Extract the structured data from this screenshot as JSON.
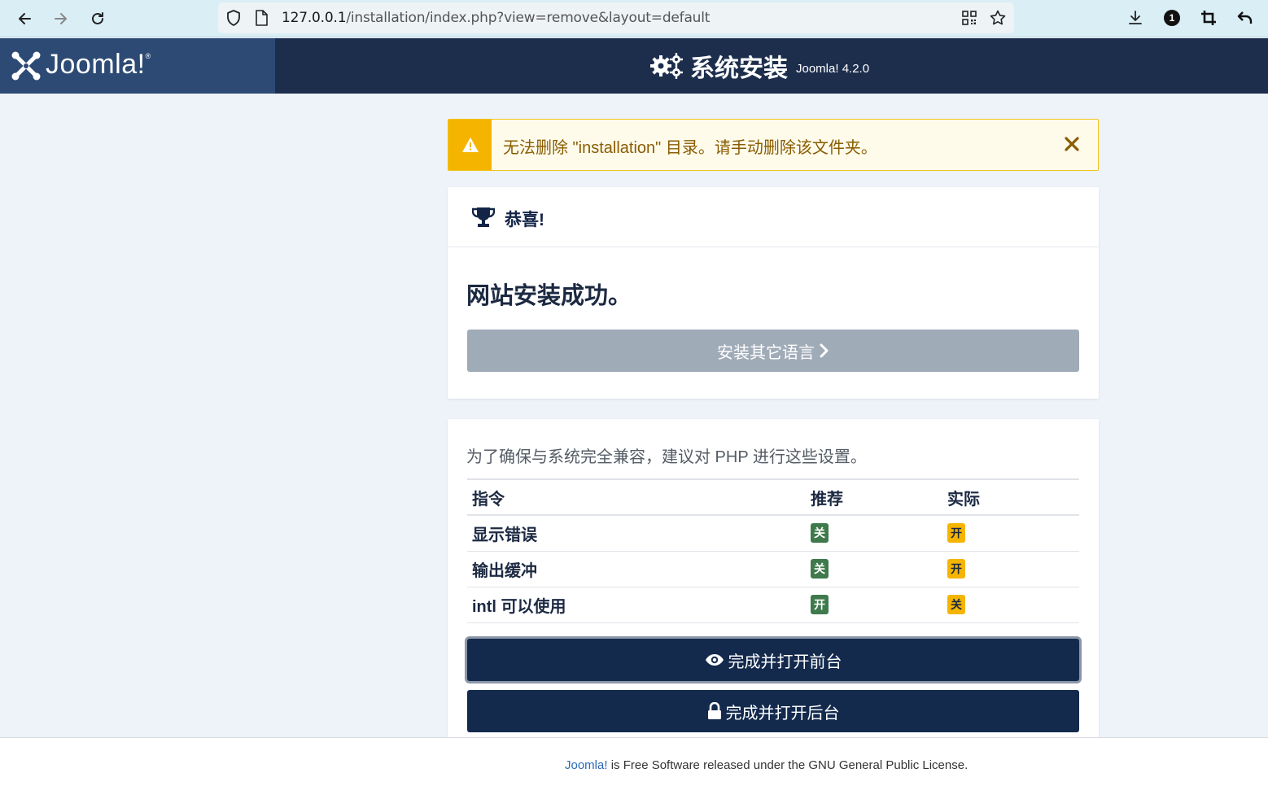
{
  "browser": {
    "url_host": "127.0.0.1",
    "url_path": "/installation/index.php?view=remove&layout=default",
    "extension_badge": "1"
  },
  "header": {
    "logo_text": "Joomla!",
    "logo_mark": "®",
    "title": "系统安装",
    "version": "Joomla! 4.2.0"
  },
  "alert": {
    "message": "无法删除 \"installation\" 目录。请手动删除该文件夹。"
  },
  "success_card": {
    "heading": "恭喜!",
    "message": "网站安装成功。",
    "install_languages_label": "安装其它语言"
  },
  "settings_card": {
    "description": "为了确保与系统完全兼容，建议对 PHP 进行这些设置。",
    "columns": [
      "指令",
      "推荐",
      "实际"
    ],
    "rows": [
      {
        "directive": "显示错误",
        "recommended": "关",
        "actual": "开"
      },
      {
        "directive": "输出缓冲",
        "recommended": "关",
        "actual": "开"
      },
      {
        "directive": "intl 可以使用",
        "recommended": "开",
        "actual": "关"
      }
    ],
    "open_site_label": "完成并打开前台",
    "open_admin_label": "完成并打开后台"
  },
  "footer": {
    "link_text": "Joomla!",
    "text": " is Free Software released under the GNU General Public License."
  },
  "colors": {
    "header_bg": "#1d2e4d",
    "logo_bg": "#2c4a74",
    "warning": "#f5b400",
    "success_badge": "#3f7a4c",
    "primary_button": "#132a4d"
  }
}
